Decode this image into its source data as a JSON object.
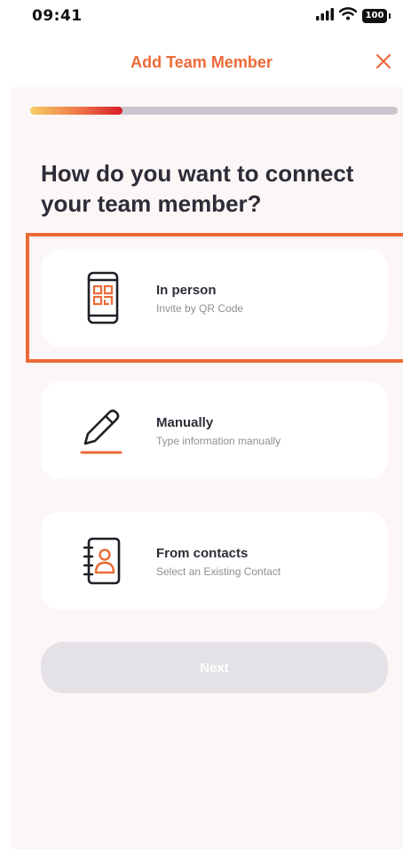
{
  "status_bar": {
    "time": "09:41",
    "battery": "100"
  },
  "header": {
    "title": "Add Team Member"
  },
  "progress": {
    "value": 0.25
  },
  "question": "How do you want to connect your team member?",
  "options": [
    {
      "title": "In person",
      "subtitle": "Invite by QR Code",
      "icon": "qr-phone-icon"
    },
    {
      "title": "Manually",
      "subtitle": "Type information manually",
      "icon": "pencil-icon"
    },
    {
      "title": "From contacts",
      "subtitle": "Select an Existing Contact",
      "icon": "contact-book-icon"
    }
  ],
  "next_button": {
    "label": "Next"
  },
  "colors": {
    "accent": "#ec6a37",
    "text": "#2d2d38",
    "subtext": "#8d8f95",
    "card_bg": "#ffffff",
    "content_bg": "#fcf7f6",
    "button_disabled": "#e4e2e7"
  }
}
